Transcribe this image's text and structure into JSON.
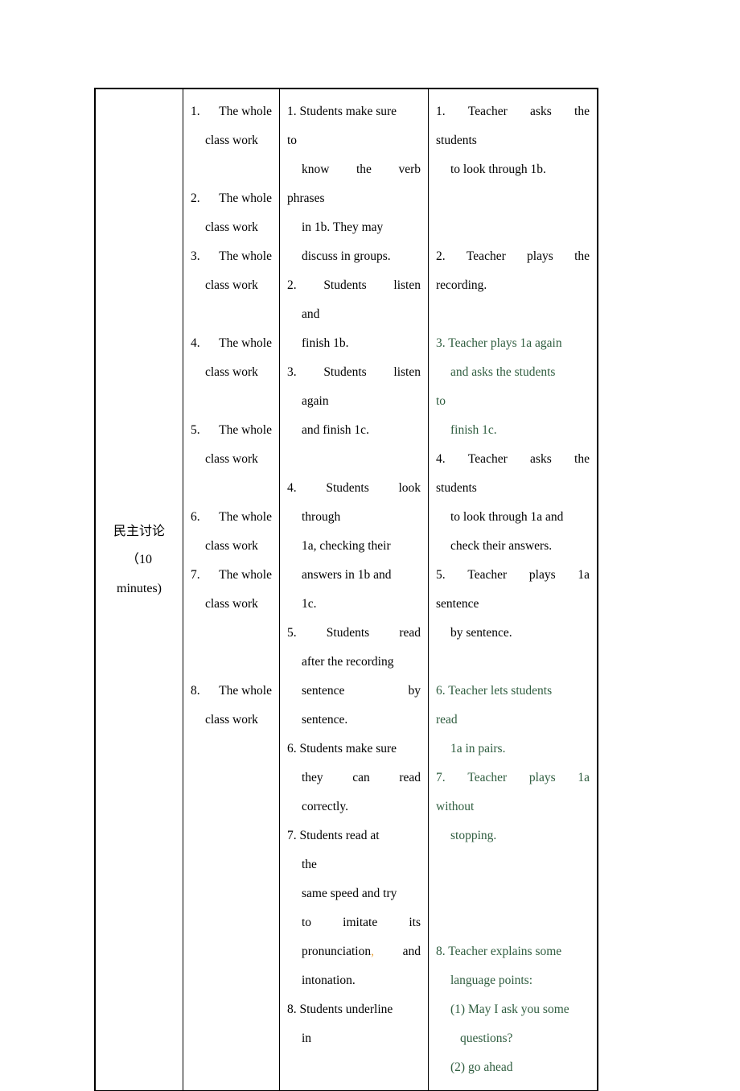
{
  "document": {
    "type": "lesson-plan-table",
    "columns": 4,
    "text_color": "#000000",
    "highlight_color": "#2f5d3f",
    "comma_color": "#e8a33d"
  },
  "stage": {
    "chinese": "民主讨论",
    "time_open": "（10",
    "time_close": "minutes)"
  },
  "organisation": {
    "items": [
      {
        "num": "1.",
        "line1": "The  whole",
        "line2": "class work",
        "gap_after": 1
      },
      {
        "num": "2.",
        "line1": "The  whole",
        "line2": "class work",
        "gap_after": 0
      },
      {
        "num": "3.",
        "line1": "The  whole",
        "line2": "class work",
        "gap_after": 1
      },
      {
        "num": "4.",
        "line1": "The  whole",
        "line2": "class work",
        "gap_after": 1
      },
      {
        "num": "5.",
        "line1": "The  whole",
        "line2": "class work",
        "gap_after": 1
      },
      {
        "num": "6.",
        "line1": "The  whole",
        "line2": "class work",
        "gap_after": 0
      },
      {
        "num": "7.",
        "line1": "The  whole",
        "line2": "class work",
        "gap_after": 2
      },
      {
        "num": "8.",
        "line1": "The  whole",
        "line2": "class work",
        "gap_after": 0
      }
    ]
  },
  "students": {
    "lines": [
      {
        "text": "1. Students make sure",
        "color": "black",
        "indent": 0,
        "justify": false
      },
      {
        "text": "to",
        "color": "black",
        "indent": 0,
        "justify": false
      },
      {
        "text": "know|the|verb",
        "color": "black",
        "indent": 1,
        "justify": true
      },
      {
        "text": "phrases",
        "color": "black",
        "indent": 0,
        "justify": false
      },
      {
        "text": "in 1b. They may",
        "color": "black",
        "indent": 1,
        "justify": false
      },
      {
        "text": "discuss in groups.",
        "color": "black",
        "indent": 1,
        "justify": false
      },
      {
        "text": "2.|Students|listen",
        "color": "black",
        "indent": 0,
        "justify": true
      },
      {
        "text": "and",
        "color": "black",
        "indent": 1,
        "justify": false
      },
      {
        "text": "finish 1b.",
        "color": "black",
        "indent": 1,
        "justify": false
      },
      {
        "text": "3.|Students|listen",
        "color": "black",
        "indent": 0,
        "justify": true
      },
      {
        "text": "again",
        "color": "black",
        "indent": 1,
        "justify": false
      },
      {
        "text": "and finish 1c.",
        "color": "black",
        "indent": 1,
        "justify": false
      },
      {
        "text": "",
        "color": "black",
        "indent": 0,
        "justify": false
      },
      {
        "text": "4.|Students|look",
        "color": "black",
        "indent": 0,
        "justify": true
      },
      {
        "text": "through",
        "color": "black",
        "indent": 1,
        "justify": false
      },
      {
        "text": "1a, checking their",
        "color": "black",
        "indent": 1,
        "justify": false
      },
      {
        "text": "answers in 1b and",
        "color": "black",
        "indent": 1,
        "justify": false
      },
      {
        "text": "1c.",
        "color": "black",
        "indent": 1,
        "justify": false
      },
      {
        "text": "5.|Students|read",
        "color": "black",
        "indent": 0,
        "justify": true
      },
      {
        "text": "after the recording",
        "color": "black",
        "indent": 1,
        "justify": false
      },
      {
        "text": "sentence|by",
        "color": "black",
        "indent": 1,
        "justify": true
      },
      {
        "text": "sentence.",
        "color": "black",
        "indent": 1,
        "justify": false
      },
      {
        "text": "6. Students make sure",
        "color": "black",
        "indent": 0,
        "justify": false
      },
      {
        "text": "they|can|read",
        "color": "black",
        "indent": 1,
        "justify": true
      },
      {
        "text": "correctly.",
        "color": "black",
        "indent": 1,
        "justify": false
      },
      {
        "text": "7. Students read at",
        "color": "black",
        "indent": 0,
        "justify": false
      },
      {
        "text": "the",
        "color": "black",
        "indent": 1,
        "justify": false
      },
      {
        "text": "same speed and try",
        "color": "black",
        "indent": 1,
        "justify": false
      },
      {
        "text": "to|imitate|its",
        "color": "black",
        "indent": 1,
        "justify": true
      },
      {
        "text": "pronunciation,|and",
        "color": "black",
        "indent": 1,
        "justify": true,
        "comma_colored": true
      },
      {
        "text": "intonation.",
        "color": "black",
        "indent": 1,
        "justify": false
      },
      {
        "text": "8. Students underline",
        "color": "black",
        "indent": 0,
        "justify": false
      },
      {
        "text": "in",
        "color": "black",
        "indent": 1,
        "justify": false
      }
    ]
  },
  "teacher": {
    "lines": [
      {
        "text": "1.|Teacher|asks|the",
        "color": "black",
        "indent": 0,
        "justify": true
      },
      {
        "text": "students",
        "color": "black",
        "indent": 0,
        "justify": false
      },
      {
        "text": "to look through 1b.",
        "color": "black",
        "indent": 1,
        "justify": false
      },
      {
        "text": "",
        "color": "black",
        "indent": 0,
        "justify": false
      },
      {
        "text": "",
        "color": "black",
        "indent": 0,
        "justify": false
      },
      {
        "text": "2.|Teacher|plays|the",
        "color": "black",
        "indent": 0,
        "justify": true
      },
      {
        "text": "recording.",
        "color": "black",
        "indent": 0,
        "justify": false
      },
      {
        "text": "",
        "color": "black",
        "indent": 0,
        "justify": false
      },
      {
        "text": "3. Teacher plays 1a again",
        "color": "green",
        "indent": 0,
        "justify": false
      },
      {
        "text": "and asks the students",
        "color": "green",
        "indent": 1,
        "justify": true
      },
      {
        "text": "to",
        "color": "green",
        "indent": 0,
        "justify": false
      },
      {
        "text": "finish 1c.",
        "color": "green",
        "indent": 1,
        "justify": false
      },
      {
        "text": "4.|Teacher|asks|the",
        "color": "black",
        "indent": 0,
        "justify": true
      },
      {
        "text": "students",
        "color": "black",
        "indent": 0,
        "justify": false
      },
      {
        "text": "to look through 1a and",
        "color": "black",
        "indent": 1,
        "justify": false
      },
      {
        "text": "check their answers.",
        "color": "black",
        "indent": 1,
        "justify": false
      },
      {
        "text": "5.|Teacher|plays|1a",
        "color": "black",
        "indent": 0,
        "justify": true
      },
      {
        "text": "sentence",
        "color": "black",
        "indent": 0,
        "justify": false
      },
      {
        "text": "by sentence.",
        "color": "black",
        "indent": 1,
        "justify": false
      },
      {
        "text": "",
        "color": "black",
        "indent": 0,
        "justify": false
      },
      {
        "text": "6. Teacher lets students",
        "color": "green",
        "indent": 0,
        "justify": false
      },
      {
        "text": "read",
        "color": "green",
        "indent": 0,
        "justify": false
      },
      {
        "text": "1a in pairs.",
        "color": "green",
        "indent": 1,
        "justify": false
      },
      {
        "text": "7.|Teacher|plays|1a",
        "color": "green",
        "indent": 0,
        "justify": true
      },
      {
        "text": "without",
        "color": "green",
        "indent": 0,
        "justify": false
      },
      {
        "text": "stopping.",
        "color": "green",
        "indent": 1,
        "justify": false
      },
      {
        "text": "",
        "color": "black",
        "indent": 0,
        "justify": false
      },
      {
        "text": "",
        "color": "black",
        "indent": 0,
        "justify": false
      },
      {
        "text": "",
        "color": "black",
        "indent": 0,
        "justify": false
      },
      {
        "text": "8. Teacher explains some",
        "color": "green",
        "indent": 0,
        "justify": false
      },
      {
        "text": "language points:",
        "color": "green",
        "indent": 1,
        "justify": false
      },
      {
        "text": "(1) May I ask you some",
        "color": "green",
        "indent": 1,
        "justify": false
      },
      {
        "text": "questions?",
        "color": "green",
        "indent": 2,
        "justify": false
      },
      {
        "text": "(2) go ahead",
        "color": "green",
        "indent": 1,
        "justify": false
      }
    ]
  }
}
